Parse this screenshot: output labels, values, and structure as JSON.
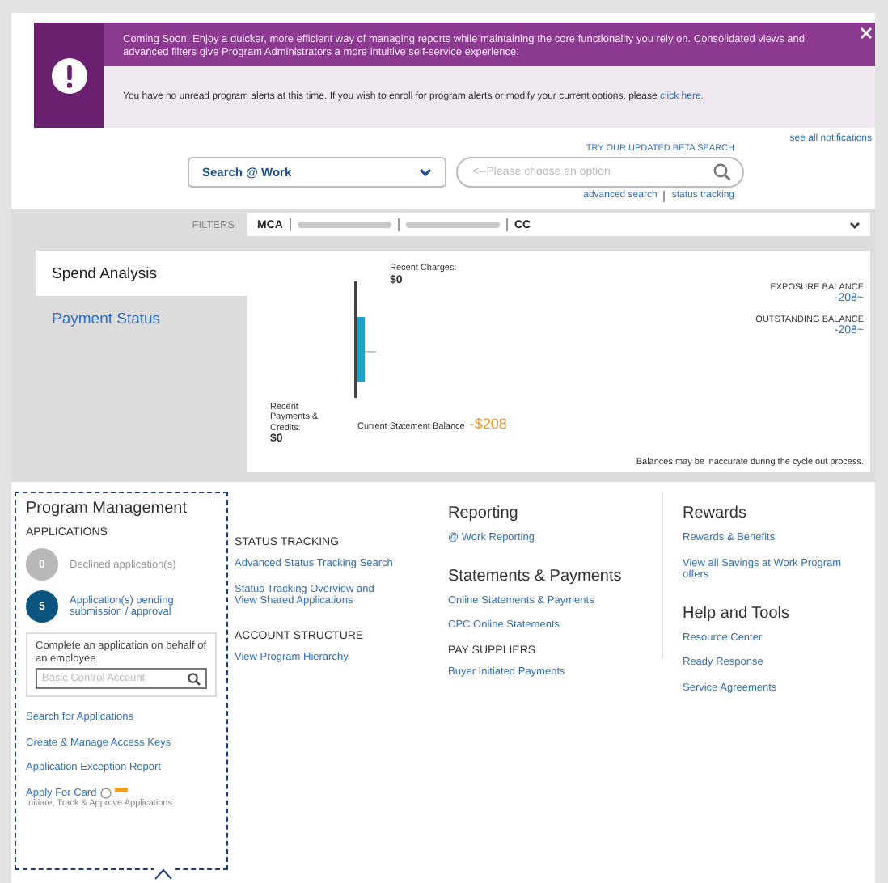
{
  "banner": {
    "message": "Coming Soon: Enjoy a quicker, more efficient way of managing reports while maintaining the core functionality you rely on. Consolidated views and advanced filters give Program Administrators a more intuitive self-service experience.",
    "alerts_text": "You have no unread program alerts at this time. If you wish to enroll for program alerts or modify your current options, please",
    "alerts_link": "click here."
  },
  "see_all_notifications": "see all notifications",
  "search": {
    "beta_link": "TRY OUR UPDATED BETA SEARCH",
    "scope": "Search @ Work",
    "placeholder": "<--Please choose an option",
    "links": [
      "advanced search",
      "status tracking"
    ]
  },
  "filters": {
    "label": "FILTERS",
    "segments": [
      {
        "kind": "text",
        "text": "MCA"
      },
      {
        "kind": "redacted"
      },
      {
        "kind": "redacted"
      },
      {
        "kind": "text",
        "text": "CC"
      }
    ]
  },
  "tabs": [
    {
      "label": "Spend Analysis",
      "selected": true
    },
    {
      "label": "Payment Status",
      "selected": false
    }
  ],
  "spend": {
    "recent_charges_label": "Recent Charges:",
    "recent_charges": "$0",
    "payments_label": "Recent Payments & Credits:",
    "payments": "$0",
    "statement_label": "Current Statement Balance",
    "statement": "-$208",
    "balances": [
      {
        "label": "EXPOSURE BALANCE",
        "value": "-208~"
      },
      {
        "label": "OUTSTANDING BALANCE",
        "value": "-208~"
      }
    ],
    "note": "Balances may be inaccurate during the cycle out process."
  },
  "program_management": {
    "title": "Program Management",
    "applications_heading": "APPLICATIONS",
    "counts": [
      {
        "count": "0",
        "label": "Declined application(s)",
        "kind": "muted"
      },
      {
        "count": "5",
        "label": "Application(s) pending submission / approval",
        "kind": "active"
      }
    ],
    "employee_prompt": "Complete an application on behalf of an employee",
    "account_placeholder": "Basic Control Account",
    "links": [
      "Search for Applications",
      "Create & Manage Access Keys",
      "Application Exception Report"
    ],
    "apply_link": "Apply For Card",
    "apply_note": "Initiate, Track & Approve Applications"
  },
  "status_tracking": {
    "heading": "STATUS TRACKING",
    "links": [
      "Advanced Status Tracking Search",
      "Status Tracking Overview and View Shared Applications"
    ],
    "account_heading": "ACCOUNT STRUCTURE",
    "account_links": [
      "View Program Hierarchy"
    ]
  },
  "reporting": {
    "title": "Reporting",
    "links": [
      "@ Work Reporting"
    ]
  },
  "statements": {
    "title": "Statements & Payments",
    "links": [
      "Online Statements & Payments",
      "CPC Online Statements"
    ],
    "pay_heading": "PAY SUPPLIERS",
    "pay_links": [
      "Buyer Initiated Payments"
    ]
  },
  "rewards": {
    "title": "Rewards",
    "links": [
      "Rewards & Benefits",
      "View all Savings at Work Program offers"
    ]
  },
  "help": {
    "title": "Help and Tools",
    "links": [
      "Resource Center",
      "Ready Response",
      "Service Agreements"
    ]
  }
}
